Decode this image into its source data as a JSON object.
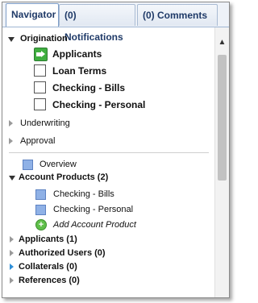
{
  "tabs": [
    {
      "label": "Navigator",
      "active": true
    },
    {
      "label": "(0) Notifications",
      "active": false
    },
    {
      "label": "(0) Comments",
      "active": false
    }
  ],
  "tree": {
    "origination": {
      "label": "Origination",
      "items": [
        {
          "label": "Applicants",
          "icon": "green-arrow-icon",
          "checked": false
        },
        {
          "label": "Loan Terms",
          "icon": "checkbox",
          "checked": false
        },
        {
          "label": "Checking - Bills",
          "icon": "checkbox",
          "checked": false
        },
        {
          "label": "Checking - Personal",
          "icon": "checkbox",
          "checked": false
        }
      ]
    },
    "underwriting": {
      "label": "Underwriting"
    },
    "approval": {
      "label": "Approval"
    },
    "overview": {
      "label": "Overview"
    },
    "account_products": {
      "label": "Account Products (2)",
      "items": [
        {
          "label": "Checking - Bills"
        },
        {
          "label": "Checking - Personal"
        }
      ],
      "add_label": "Add Account Product"
    },
    "applicants": {
      "label": "Applicants (1)"
    },
    "authorized_users": {
      "label": "Authorized Users (0)"
    },
    "collaterals": {
      "label": "Collaterals (0)"
    },
    "references": {
      "label": "References (0)"
    }
  },
  "colors": {
    "tab_text": "#1f3a68",
    "square_icon": "#8fb1e6",
    "green_icon": "#3fae3f",
    "expander_blue": "#2f8fd8"
  }
}
